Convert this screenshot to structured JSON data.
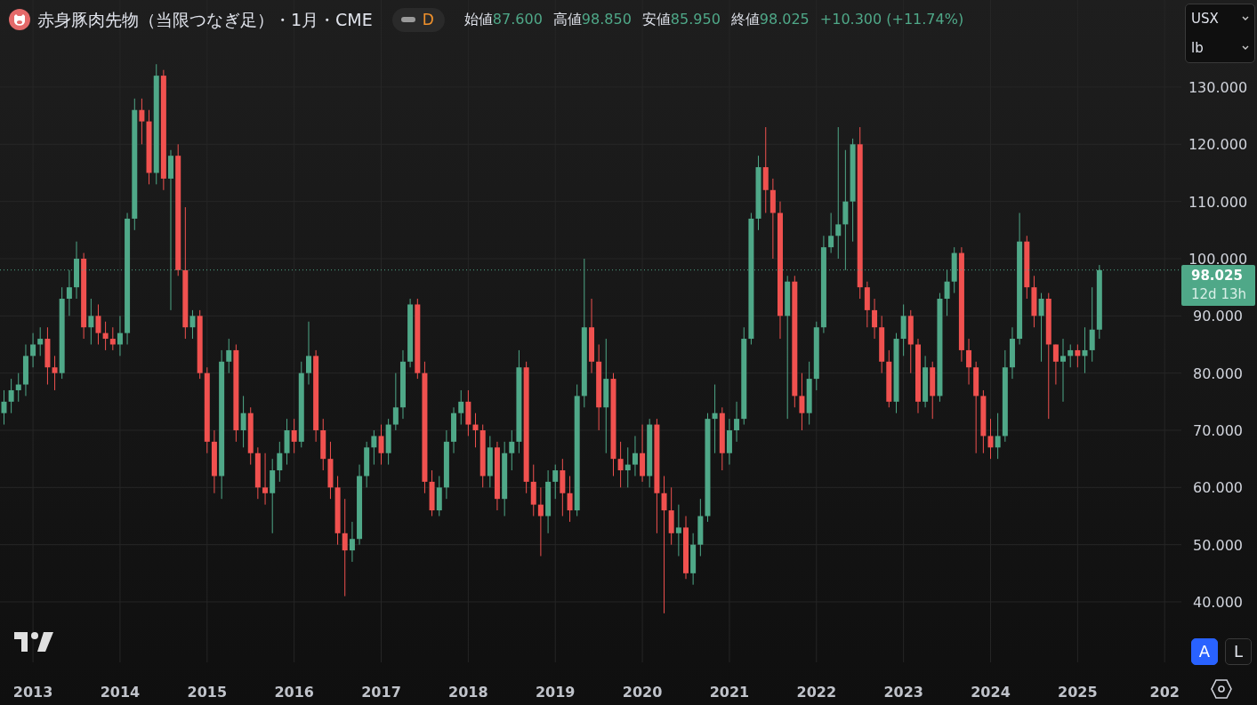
{
  "header": {
    "title": "赤身豚肉先物（当限つなぎ足）・1月・CME",
    "interval": "D",
    "ohlc": [
      {
        "label": "始値",
        "value": "87.600"
      },
      {
        "label": "高値",
        "value": "98.850"
      },
      {
        "label": "安値",
        "value": "85.950"
      },
      {
        "label": "終値",
        "value": "98.025"
      }
    ],
    "change": "+10.300 (+11.74%)"
  },
  "units": [
    {
      "value": "USX"
    },
    {
      "value": "lb"
    }
  ],
  "chart": {
    "edge_time_label": "202",
    "last_price": {
      "label": "98.025",
      "countdown": "12d 13h"
    },
    "chart_data": {
      "type": "candlestick",
      "grid": true,
      "ylim": [
        29.43,
        145.23
      ],
      "xlim": [
        2012.621,
        2026.192
      ],
      "yticks": [
        {
          "value": 40,
          "label": "40.000"
        },
        {
          "value": 50,
          "label": "50.000"
        },
        {
          "value": 60,
          "label": "60.000"
        },
        {
          "value": 70,
          "label": "70.000"
        },
        {
          "value": 80,
          "label": "80.000"
        },
        {
          "value": 90,
          "label": "90.000"
        },
        {
          "value": 100,
          "label": "100.000"
        },
        {
          "value": 110,
          "label": "110.000"
        },
        {
          "value": 120,
          "label": "120.000"
        },
        {
          "value": 130,
          "label": "130.000"
        }
      ],
      "xticks": [
        2013,
        2014,
        2015,
        2016,
        2017,
        2018,
        2019,
        2020,
        2021,
        2022,
        2023,
        2024,
        2025
      ],
      "x": [
        2012.667,
        2012.75,
        2012.833,
        2012.917,
        2013,
        2013.083,
        2013.167,
        2013.25,
        2013.333,
        2013.417,
        2013.5,
        2013.583,
        2013.667,
        2013.75,
        2013.833,
        2013.917,
        2014,
        2014.083,
        2014.167,
        2014.25,
        2014.333,
        2014.417,
        2014.5,
        2014.583,
        2014.667,
        2014.75,
        2014.833,
        2014.917,
        2015,
        2015.083,
        2015.167,
        2015.25,
        2015.333,
        2015.417,
        2015.5,
        2015.583,
        2015.667,
        2015.75,
        2015.833,
        2015.917,
        2016,
        2016.083,
        2016.167,
        2016.25,
        2016.333,
        2016.417,
        2016.5,
        2016.583,
        2016.667,
        2016.75,
        2016.833,
        2016.917,
        2017,
        2017.083,
        2017.167,
        2017.25,
        2017.333,
        2017.417,
        2017.5,
        2017.583,
        2017.667,
        2017.75,
        2017.833,
        2017.917,
        2018,
        2018.083,
        2018.167,
        2018.25,
        2018.333,
        2018.417,
        2018.5,
        2018.583,
        2018.667,
        2018.75,
        2018.833,
        2018.917,
        2019,
        2019.083,
        2019.167,
        2019.25,
        2019.333,
        2019.417,
        2019.5,
        2019.583,
        2019.667,
        2019.75,
        2019.833,
        2019.917,
        2020,
        2020.083,
        2020.167,
        2020.25,
        2020.333,
        2020.417,
        2020.5,
        2020.583,
        2020.667,
        2020.75,
        2020.833,
        2020.917,
        2021,
        2021.083,
        2021.167,
        2021.25,
        2021.333,
        2021.417,
        2021.5,
        2021.583,
        2021.667,
        2021.75,
        2021.833,
        2021.917,
        2022,
        2022.083,
        2022.167,
        2022.25,
        2022.333,
        2022.417,
        2022.5,
        2022.583,
        2022.667,
        2022.75,
        2022.833,
        2022.917,
        2023,
        2023.083,
        2023.167,
        2023.25,
        2023.333,
        2023.417,
        2023.5,
        2023.583,
        2023.667,
        2023.75,
        2023.833,
        2023.917,
        2024,
        2024.083,
        2024.167,
        2024.25,
        2024.333,
        2024.417,
        2024.5,
        2024.583,
        2024.667,
        2024.75,
        2024.833,
        2024.917,
        2025,
        2025.083,
        2025.167,
        2025.25
      ],
      "ohlc": [
        [
          73,
          77,
          71,
          75
        ],
        [
          75,
          79,
          73,
          77
        ],
        [
          77,
          80,
          75,
          78
        ],
        [
          78,
          85,
          76,
          83
        ],
        [
          83,
          87,
          81,
          85
        ],
        [
          85,
          88,
          83,
          86
        ],
        [
          86,
          88,
          78,
          81
        ],
        [
          81,
          83,
          77,
          80
        ],
        [
          80,
          95,
          79,
          93
        ],
        [
          93,
          98,
          90,
          95
        ],
        [
          95,
          103,
          93,
          100
        ],
        [
          100,
          101,
          86,
          88
        ],
        [
          88,
          93,
          85,
          90
        ],
        [
          90,
          92,
          85,
          87
        ],
        [
          87,
          89,
          84,
          86
        ],
        [
          86,
          88,
          84,
          85
        ],
        [
          85,
          90,
          83,
          87
        ],
        [
          87,
          108,
          85,
          107
        ],
        [
          107,
          128,
          105,
          126
        ],
        [
          126,
          128,
          120,
          124
        ],
        [
          124,
          126,
          113,
          115
        ],
        [
          115,
          134,
          113,
          132
        ],
        [
          132,
          133,
          112,
          114
        ],
        [
          114,
          119,
          91,
          118
        ],
        [
          118,
          120,
          97,
          98
        ],
        [
          98,
          109,
          86,
          88
        ],
        [
          88,
          91,
          86,
          90
        ],
        [
          90,
          91,
          79,
          80
        ],
        [
          80,
          81,
          66,
          68
        ],
        [
          68,
          70,
          59,
          62
        ],
        [
          62,
          84,
          58,
          82
        ],
        [
          82,
          86,
          80,
          84
        ],
        [
          84,
          85,
          68,
          70
        ],
        [
          70,
          76,
          67,
          73
        ],
        [
          73,
          74,
          64,
          66
        ],
        [
          66,
          67,
          58,
          60
        ],
        [
          60,
          66,
          57,
          59
        ],
        [
          59,
          65,
          52,
          63
        ],
        [
          63,
          68,
          61,
          66
        ],
        [
          66,
          72,
          64,
          70
        ],
        [
          70,
          72,
          66,
          68
        ],
        [
          68,
          82,
          67,
          80
        ],
        [
          80,
          89,
          78,
          83
        ],
        [
          83,
          84,
          68,
          70
        ],
        [
          70,
          72,
          63,
          65
        ],
        [
          65,
          68,
          58,
          60
        ],
        [
          60,
          62,
          50,
          52
        ],
        [
          52,
          58,
          41,
          49
        ],
        [
          49,
          54,
          47,
          51
        ],
        [
          51,
          64,
          50,
          62
        ],
        [
          62,
          68,
          60,
          67
        ],
        [
          67,
          70,
          64,
          69
        ],
        [
          69,
          71,
          64,
          66
        ],
        [
          66,
          72,
          64,
          71
        ],
        [
          71,
          80,
          70,
          74
        ],
        [
          74,
          84,
          72,
          82
        ],
        [
          82,
          93,
          81,
          92
        ],
        [
          92,
          93,
          79,
          80
        ],
        [
          80,
          82,
          59,
          61
        ],
        [
          61,
          63,
          55,
          56
        ],
        [
          56,
          62,
          55,
          60
        ],
        [
          60,
          70,
          58,
          68
        ],
        [
          68,
          74,
          66,
          73
        ],
        [
          73,
          77,
          71,
          75
        ],
        [
          75,
          77,
          69,
          71
        ],
        [
          71,
          73,
          67,
          70
        ],
        [
          70,
          71,
          60,
          62
        ],
        [
          62,
          69,
          60,
          67
        ],
        [
          67,
          68,
          56,
          58
        ],
        [
          58,
          68,
          55,
          66
        ],
        [
          66,
          70,
          63,
          68
        ],
        [
          68,
          84,
          66,
          81
        ],
        [
          81,
          82,
          59,
          61
        ],
        [
          61,
          64,
          55,
          57
        ],
        [
          57,
          60,
          48,
          55
        ],
        [
          55,
          63,
          52,
          61
        ],
        [
          61,
          64,
          58,
          63
        ],
        [
          63,
          65,
          55,
          59
        ],
        [
          59,
          62,
          54,
          56
        ],
        [
          56,
          78,
          55,
          76
        ],
        [
          76,
          100,
          74,
          88
        ],
        [
          88,
          93,
          80,
          82
        ],
        [
          82,
          85,
          70,
          74
        ],
        [
          74,
          86,
          66,
          79
        ],
        [
          79,
          80,
          62,
          65
        ],
        [
          65,
          68,
          60,
          63
        ],
        [
          63,
          67,
          60,
          64
        ],
        [
          64,
          69,
          62,
          66
        ],
        [
          66,
          71,
          61,
          62
        ],
        [
          62,
          72,
          60,
          71
        ],
        [
          71,
          72,
          52,
          59
        ],
        [
          59,
          62,
          38,
          56
        ],
        [
          56,
          60,
          50,
          52
        ],
        [
          52,
          57,
          48,
          53
        ],
        [
          53,
          55,
          44,
          45
        ],
        [
          45,
          52,
          43,
          50
        ],
        [
          50,
          58,
          48,
          55
        ],
        [
          55,
          73,
          54,
          72
        ],
        [
          72,
          78,
          66,
          73
        ],
        [
          73,
          74,
          63,
          66
        ],
        [
          66,
          72,
          64,
          70
        ],
        [
          70,
          75,
          68,
          72
        ],
        [
          72,
          88,
          71,
          86
        ],
        [
          86,
          108,
          85,
          107
        ],
        [
          107,
          118,
          105,
          116
        ],
        [
          116,
          123,
          108,
          112
        ],
        [
          112,
          114,
          100,
          108
        ],
        [
          108,
          110,
          86,
          90
        ],
        [
          90,
          97,
          72,
          96
        ],
        [
          96,
          97,
          74,
          76
        ],
        [
          76,
          80,
          70,
          73
        ],
        [
          73,
          82,
          71,
          79
        ],
        [
          79,
          89,
          77,
          88
        ],
        [
          88,
          104,
          87,
          102
        ],
        [
          102,
          108,
          101,
          104
        ],
        [
          104,
          123,
          100,
          106
        ],
        [
          106,
          119,
          98,
          110
        ],
        [
          110,
          121,
          103,
          120
        ],
        [
          120,
          123,
          93,
          95
        ],
        [
          95,
          96,
          88,
          91
        ],
        [
          91,
          93,
          86,
          88
        ],
        [
          88,
          90,
          80,
          82
        ],
        [
          82,
          84,
          74,
          75
        ],
        [
          75,
          87,
          73,
          86
        ],
        [
          86,
          92,
          83,
          90
        ],
        [
          90,
          91,
          80,
          85
        ],
        [
          85,
          86,
          73,
          75
        ],
        [
          75,
          83,
          74,
          81
        ],
        [
          81,
          82,
          72,
          76
        ],
        [
          76,
          94,
          75,
          93
        ],
        [
          93,
          98,
          90,
          96
        ],
        [
          96,
          102,
          94,
          101
        ],
        [
          101,
          102,
          82,
          84
        ],
        [
          84,
          86,
          78,
          81
        ],
        [
          81,
          82,
          66,
          76
        ],
        [
          76,
          77,
          66,
          69
        ],
        [
          69,
          72,
          65,
          67
        ],
        [
          67,
          73,
          65,
          69
        ],
        [
          69,
          84,
          68,
          81
        ],
        [
          81,
          88,
          79,
          86
        ],
        [
          86,
          108,
          85,
          103
        ],
        [
          103,
          104,
          93,
          95
        ],
        [
          95,
          97,
          88,
          90
        ],
        [
          90,
          94,
          82,
          93
        ],
        [
          93,
          94,
          72,
          85
        ],
        [
          85,
          85,
          78,
          82
        ],
        [
          82,
          86,
          75,
          83
        ],
        [
          83,
          85,
          81,
          84
        ],
        [
          84,
          85,
          81,
          83
        ],
        [
          83,
          88,
          80,
          84
        ],
        [
          84,
          95,
          82,
          87.6
        ],
        [
          87.6,
          98.9,
          86,
          98
        ]
      ]
    }
  },
  "scale_modes": [
    {
      "label": "A",
      "selected": true
    },
    {
      "label": "L",
      "selected": false
    }
  ]
}
